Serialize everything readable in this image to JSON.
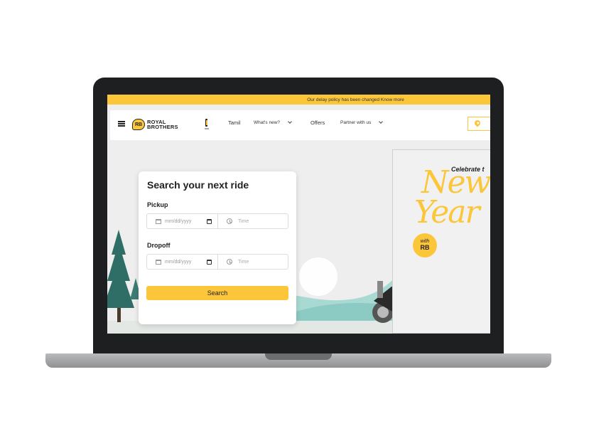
{
  "announcement": {
    "text": "Our delay policy has been changed Know more"
  },
  "header": {
    "logo": {
      "badge": "RB",
      "line1": "ROYAL",
      "line2": "BROTHERS"
    },
    "nav": [
      {
        "label": "Tamil",
        "icon": ""
      },
      {
        "label": "What's new?",
        "icon": "chevron-down-icon"
      },
      {
        "label": "Offers",
        "icon": ""
      },
      {
        "label": "Partner with us",
        "icon": "chevron-down-icon"
      }
    ],
    "location_icon": "location-pin-icon"
  },
  "search": {
    "title": "Search your next ride",
    "pickup": {
      "label": "Pickup",
      "date_placeholder": "mm/dd/yyyy",
      "time_placeholder": "Time"
    },
    "dropoff": {
      "label": "Dropoff",
      "date_placeholder": "mm/dd/yyyy",
      "time_placeholder": "Time"
    },
    "button_label": "Search"
  },
  "banner": {
    "celebrate": "Celebrate t",
    "line1": "New",
    "line2": "Year",
    "with": "with",
    "rb": "RB"
  },
  "colors": {
    "accent": "#fcc63b",
    "bezel": "#1e1f21",
    "page_bg": "#eeeeee"
  }
}
